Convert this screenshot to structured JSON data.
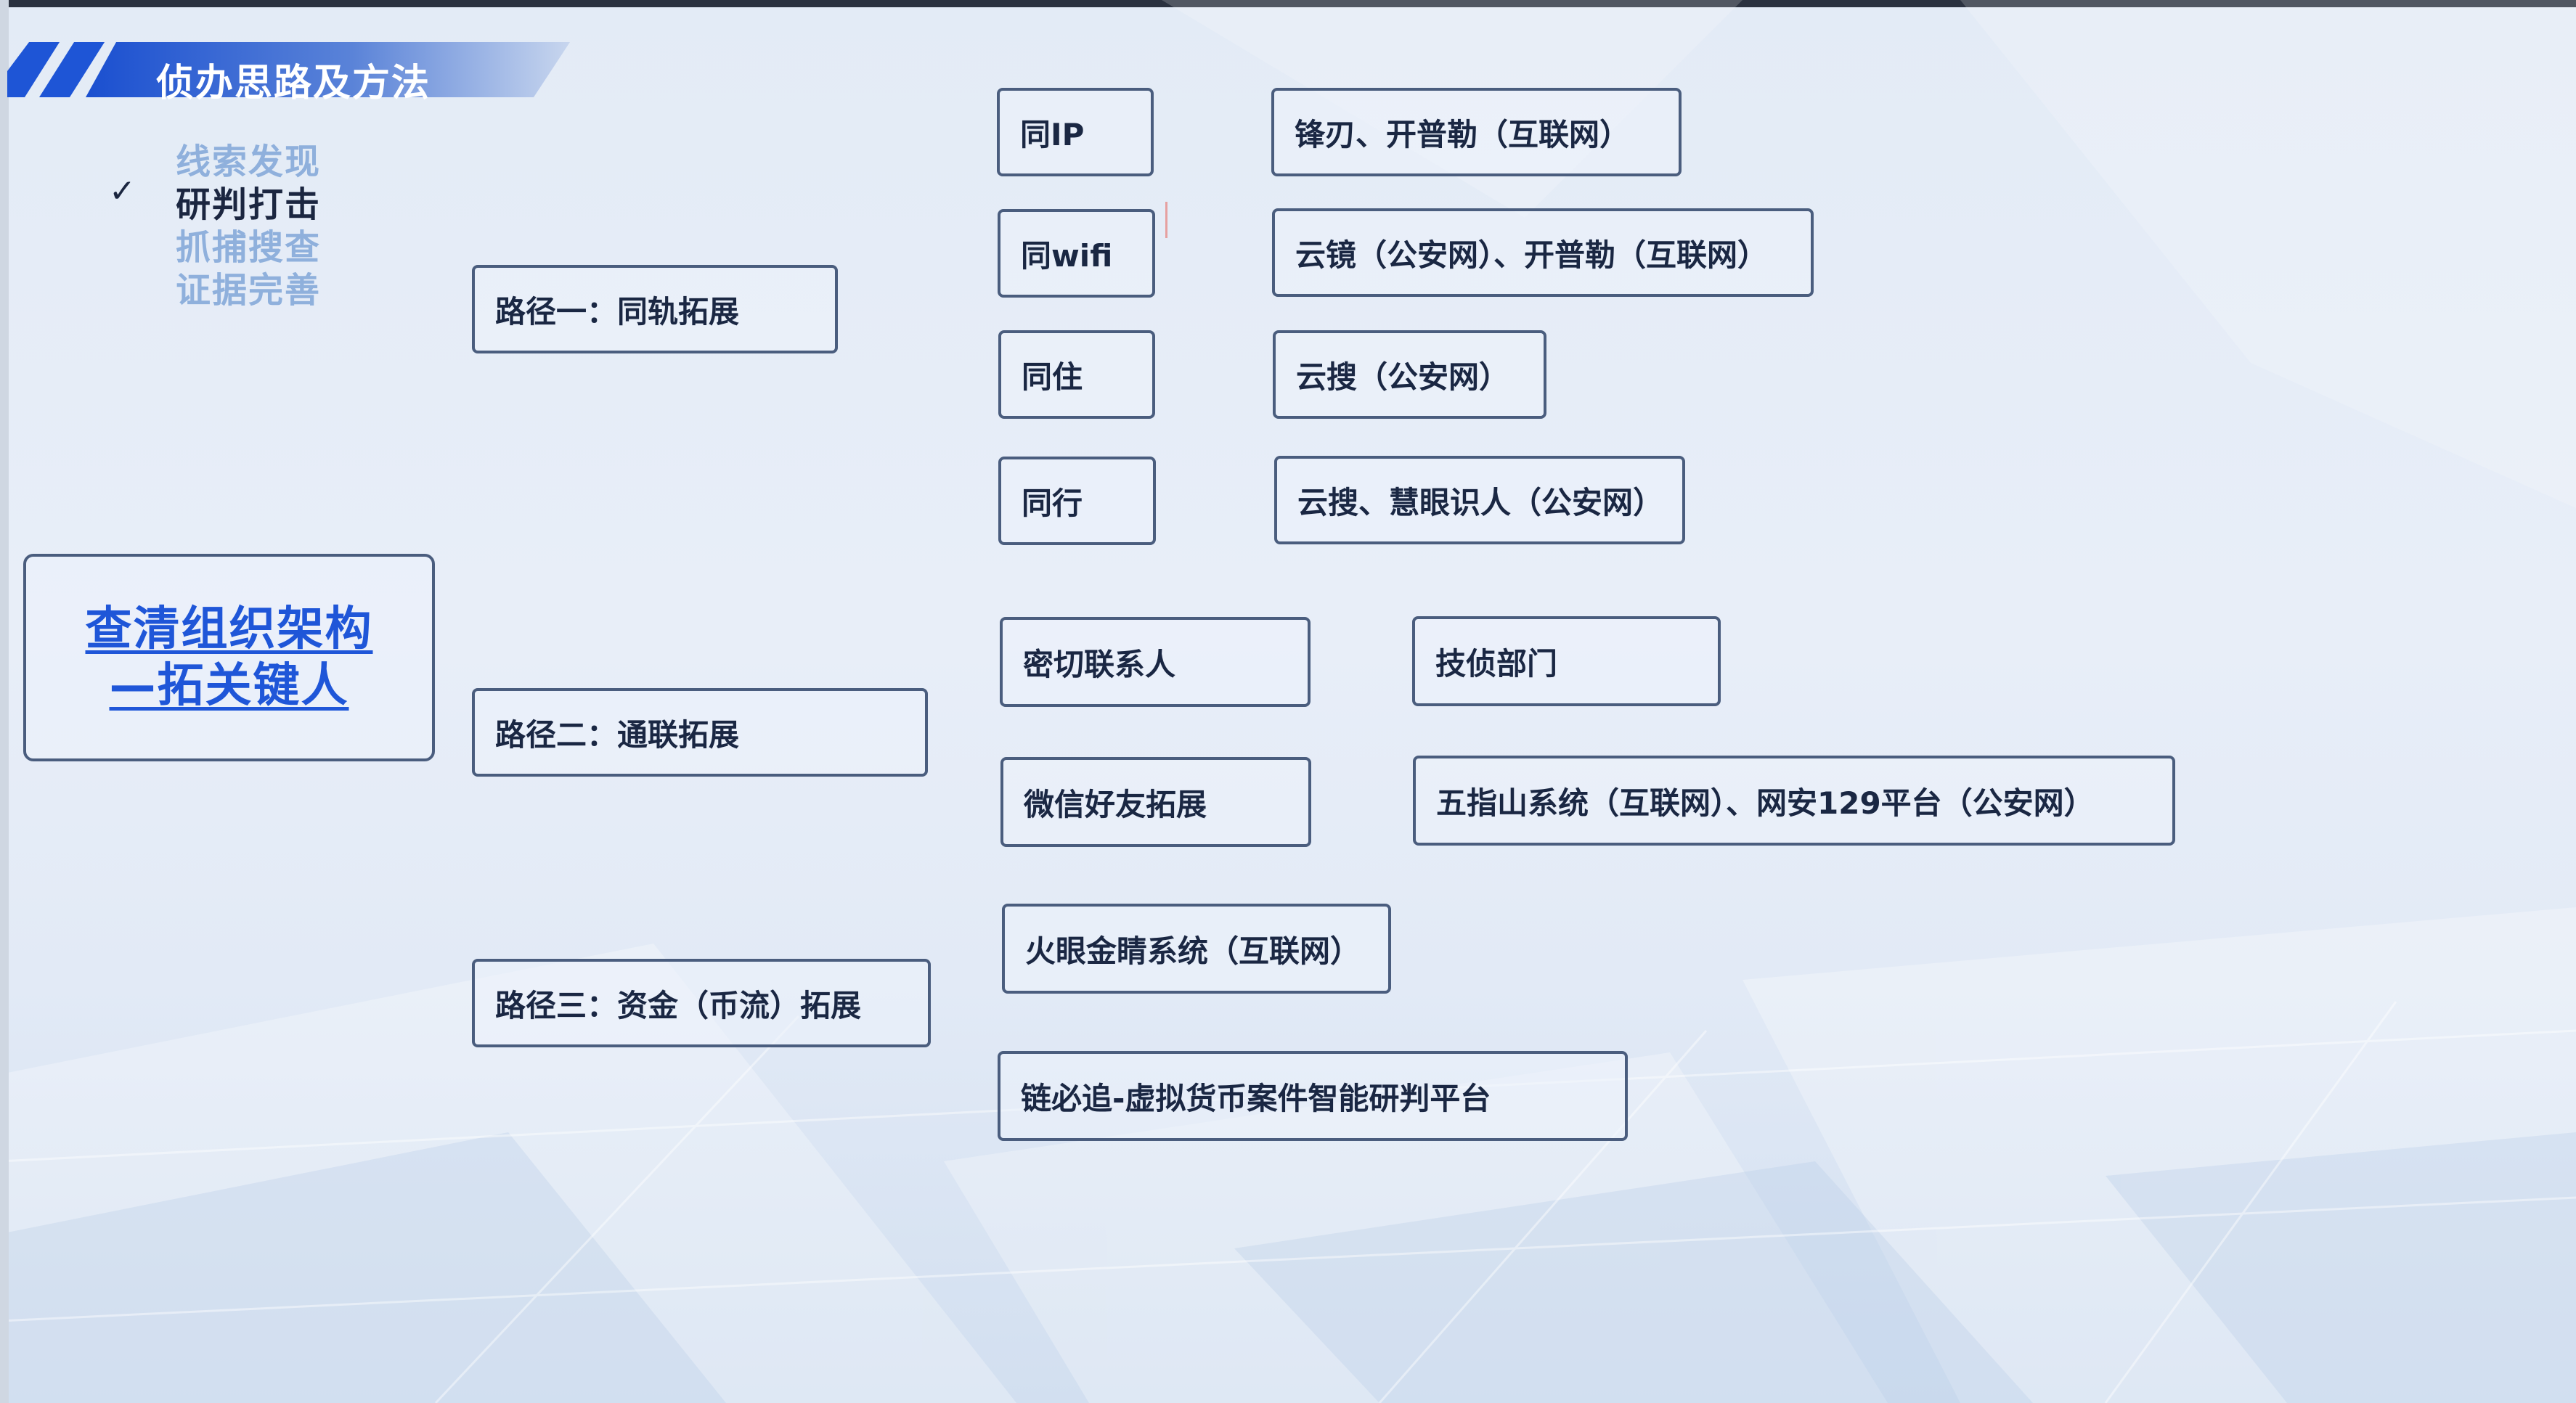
{
  "header": {
    "title": "侦办思路及方法"
  },
  "steps": [
    {
      "label": "线索发现",
      "active": false
    },
    {
      "label": "研判打击",
      "active": true
    },
    {
      "label": "抓捕搜查",
      "active": false
    },
    {
      "label": "证据完善",
      "active": false
    }
  ],
  "check_mark": "✓",
  "main_topic": {
    "line1": "查清组织架构",
    "line2": "—拓关键人"
  },
  "paths": [
    {
      "label": "路径一：同轨拓展"
    },
    {
      "label": "路径二：通联拓展"
    },
    {
      "label": "路径三：资金（币流）拓展"
    }
  ],
  "path1_items": [
    {
      "method": "同IP",
      "tool": "锋刃、开普勒（互联网）"
    },
    {
      "method": "同wifi",
      "tool": "云镜（公安网）、开普勒（互联网）"
    },
    {
      "method": "同住",
      "tool": "云搜（公安网）"
    },
    {
      "method": "同行",
      "tool": "云搜、慧眼识人（公安网）"
    }
  ],
  "path2_items": [
    {
      "method": "密切联系人",
      "tool": "技侦部门"
    },
    {
      "method": "微信好友拓展",
      "tool": "五指山系统（互联网）、网安129平台（公安网）"
    }
  ],
  "path3_items": [
    {
      "tool": "火眼金睛系统（互联网）"
    },
    {
      "tool": "链必追-虚拟货币案件智能研判平台"
    }
  ],
  "colors": {
    "box_border": "#4a5d7e",
    "main_text": "#1f56d8",
    "banner": "#1e55d6",
    "step_dim": "#8fb0dc",
    "step_active": "#1b2640"
  }
}
